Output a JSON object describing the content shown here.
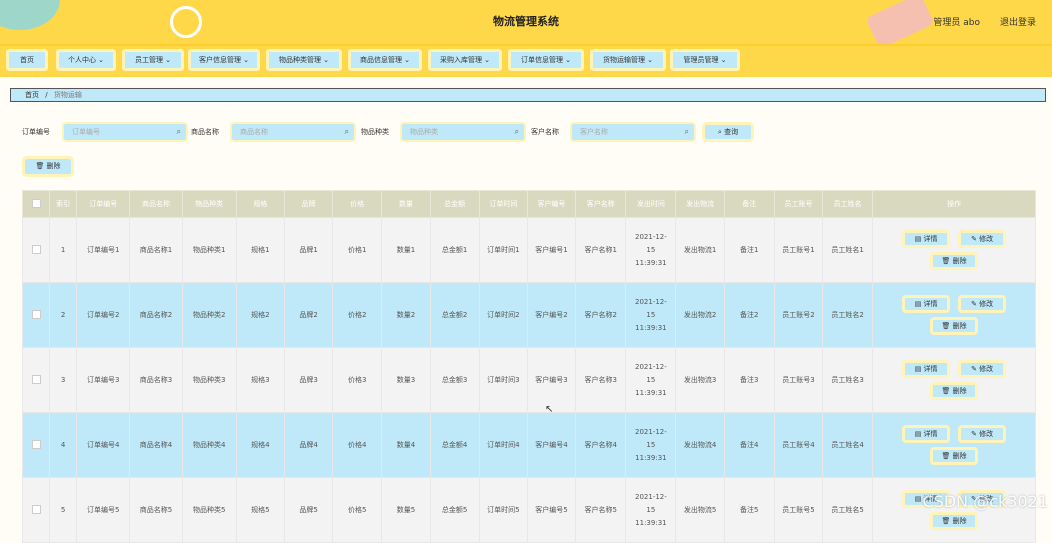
{
  "header": {
    "title": "物流管理系统",
    "user": "管理员 abo",
    "logout": "退出登录"
  },
  "nav": [
    {
      "label": "首页"
    },
    {
      "label": "个人中心 ⌄"
    },
    {
      "label": "员工管理 ⌄"
    },
    {
      "label": "客户信息管理 ⌄"
    },
    {
      "label": "物品种类管理 ⌄"
    },
    {
      "label": "商品信息管理 ⌄"
    },
    {
      "label": "采购入库管理 ⌄"
    },
    {
      "label": "订单信息管理 ⌄"
    },
    {
      "label": "货物运输管理 ⌄"
    },
    {
      "label": "管理员管理 ⌄"
    }
  ],
  "breadcrumb": {
    "home": "首页",
    "sep": "/",
    "current": "货物运输"
  },
  "search": {
    "order_label": "订单编号",
    "order_placeholder": "订单编号",
    "goods_label": "商品名称",
    "goods_placeholder": "商品名称",
    "kind_label": "物品种类",
    "kind_placeholder": "物品种类",
    "customer_label": "客户名称",
    "customer_placeholder": "客户名称",
    "query": "⌕ 查询"
  },
  "delete_label": "🗑 删除",
  "table": {
    "headers": [
      "",
      "索引",
      "订单编号",
      "商品名称",
      "物品种类",
      "规格",
      "品牌",
      "价格",
      "数量",
      "总金额",
      "订单时间",
      "客户编号",
      "客户名称",
      "发出时间",
      "发出物流",
      "备注",
      "员工账号",
      "员工姓名",
      "操作"
    ],
    "rows": [
      [
        "1",
        "订单编号1",
        "商品名称1",
        "物品种类1",
        "规格1",
        "品牌1",
        "价格1",
        "数量1",
        "总金额1",
        "订单时间1",
        "客户编号1",
        "客户名称1",
        "2021-12-15 11:39:31",
        "发出物流1",
        "备注1",
        "员工账号1",
        "员工姓名1"
      ],
      [
        "2",
        "订单编号2",
        "商品名称2",
        "物品种类2",
        "规格2",
        "品牌2",
        "价格2",
        "数量2",
        "总金额2",
        "订单时间2",
        "客户编号2",
        "客户名称2",
        "2021-12-15 11:39:31",
        "发出物流2",
        "备注2",
        "员工账号2",
        "员工姓名2"
      ],
      [
        "3",
        "订单编号3",
        "商品名称3",
        "物品种类3",
        "规格3",
        "品牌3",
        "价格3",
        "数量3",
        "总金额3",
        "订单时间3",
        "客户编号3",
        "客户名称3",
        "2021-12-15 11:39:31",
        "发出物流3",
        "备注3",
        "员工账号3",
        "员工姓名3"
      ],
      [
        "4",
        "订单编号4",
        "商品名称4",
        "物品种类4",
        "规格4",
        "品牌4",
        "价格4",
        "数量4",
        "总金额4",
        "订单时间4",
        "客户编号4",
        "客户名称4",
        "2021-12-15 11:39:31",
        "发出物流4",
        "备注4",
        "员工账号4",
        "员工姓名4"
      ],
      [
        "5",
        "订单编号5",
        "商品名称5",
        "物品种类5",
        "规格5",
        "品牌5",
        "价格5",
        "数量5",
        "总金额5",
        "订单时间5",
        "客户编号5",
        "客户名称5",
        "2021-12-15 11:39:31",
        "发出物流5",
        "备注5",
        "员工账号5",
        "员工姓名5"
      ]
    ],
    "ops": {
      "detail": "▤ 详情",
      "edit": "✎ 修改",
      "delete": "🗑 删除"
    }
  },
  "watermark": "CSDN @ck3021",
  "colors": {
    "yellow": "#ffd84a",
    "blue": "#bfe9f8",
    "header_gray": "#d9d9c0"
  }
}
